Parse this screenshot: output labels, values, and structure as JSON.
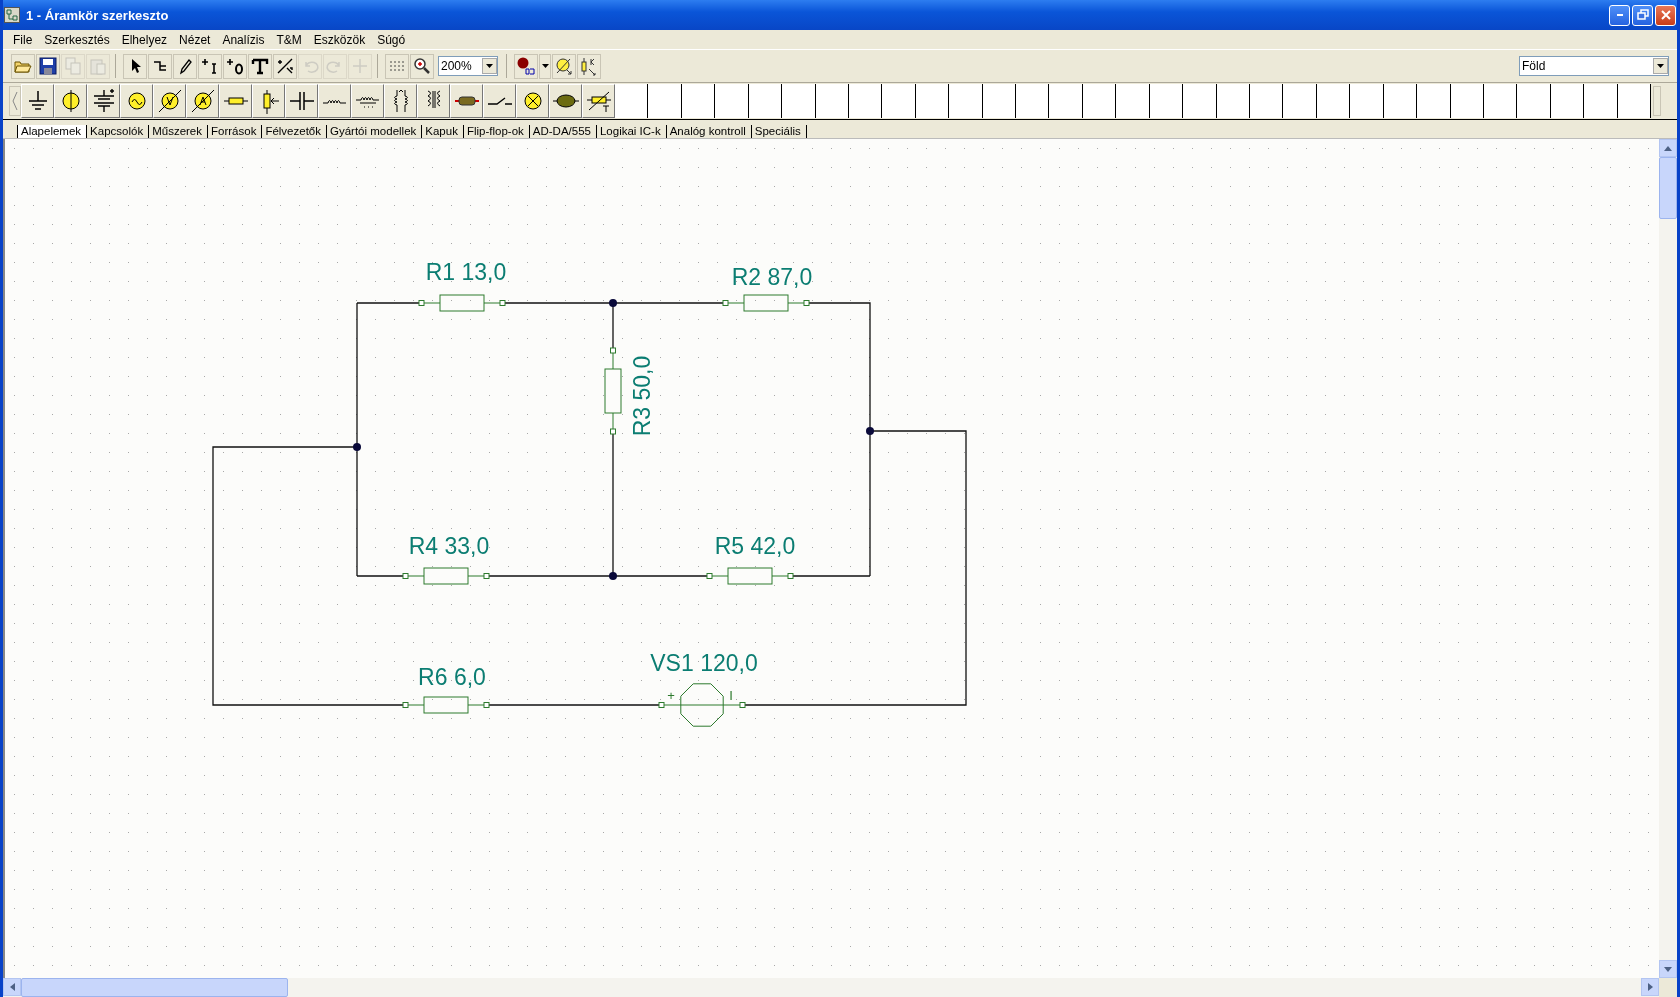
{
  "window": {
    "title": "1 - Áramkör szerkeszto"
  },
  "menu": [
    "File",
    "Szerkesztés",
    "Elhelyez",
    "Nézet",
    "Analízis",
    "T&M",
    "Eszközök",
    "Súgó"
  ],
  "toolbar": [
    {
      "kind": "open",
      "disabled": false
    },
    {
      "kind": "save",
      "disabled": false
    },
    {
      "kind": "copy",
      "disabled": true
    },
    {
      "kind": "paste",
      "disabled": true
    },
    {
      "kind": "sep"
    },
    {
      "kind": "pointer",
      "disabled": false
    },
    {
      "kind": "wire",
      "disabled": false
    },
    {
      "kind": "pencil",
      "disabled": false
    },
    {
      "kind": "plus-i",
      "disabled": false
    },
    {
      "kind": "plus-0",
      "disabled": false
    },
    {
      "kind": "text",
      "disabled": false
    },
    {
      "kind": "arrow-edit",
      "disabled": false
    },
    {
      "kind": "undo",
      "disabled": true
    },
    {
      "kind": "redo",
      "disabled": true
    },
    {
      "kind": "cross",
      "disabled": true
    },
    {
      "kind": "sep"
    },
    {
      "kind": "grid",
      "disabled": false
    },
    {
      "kind": "zoom",
      "disabled": false
    }
  ],
  "zoom_combo": {
    "value": "200%"
  },
  "toolbar2": [
    {
      "kind": "dc",
      "disabled": false
    },
    {
      "kind": "meter",
      "disabled": false
    },
    {
      "kind": "tuner",
      "disabled": false
    }
  ],
  "ground_combo": {
    "value": "Föld"
  },
  "tabs": [
    {
      "label": "Alapelemek",
      "selected": true
    },
    {
      "label": "Kapcsolók",
      "selected": false
    },
    {
      "label": "Műszerek",
      "selected": false
    },
    {
      "label": "Források",
      "selected": false
    },
    {
      "label": "Félvezetők",
      "selected": false
    },
    {
      "label": "Gyártói modellek",
      "selected": false
    },
    {
      "label": "Kapuk",
      "selected": false
    },
    {
      "label": "Flip-flop-ok",
      "selected": false
    },
    {
      "label": "AD-DA/555",
      "selected": false
    },
    {
      "label": "Logikai IC-k",
      "selected": false
    },
    {
      "label": "Analóg kontroll",
      "selected": false
    },
    {
      "label": "Speciális",
      "selected": false
    }
  ],
  "components": [
    {
      "kind": "resistor",
      "label": "R1 13,0"
    },
    {
      "kind": "resistor",
      "label": "R2 87,0"
    },
    {
      "kind": "resistor",
      "label": "R3 50,0"
    },
    {
      "kind": "resistor",
      "label": "R4 33,0"
    },
    {
      "kind": "resistor",
      "label": "R5 42,0"
    },
    {
      "kind": "resistor",
      "label": "R6 6,0"
    },
    {
      "kind": "voltage_source",
      "label": "VS1 120,0",
      "plus": "+",
      "minus": "I"
    }
  ]
}
